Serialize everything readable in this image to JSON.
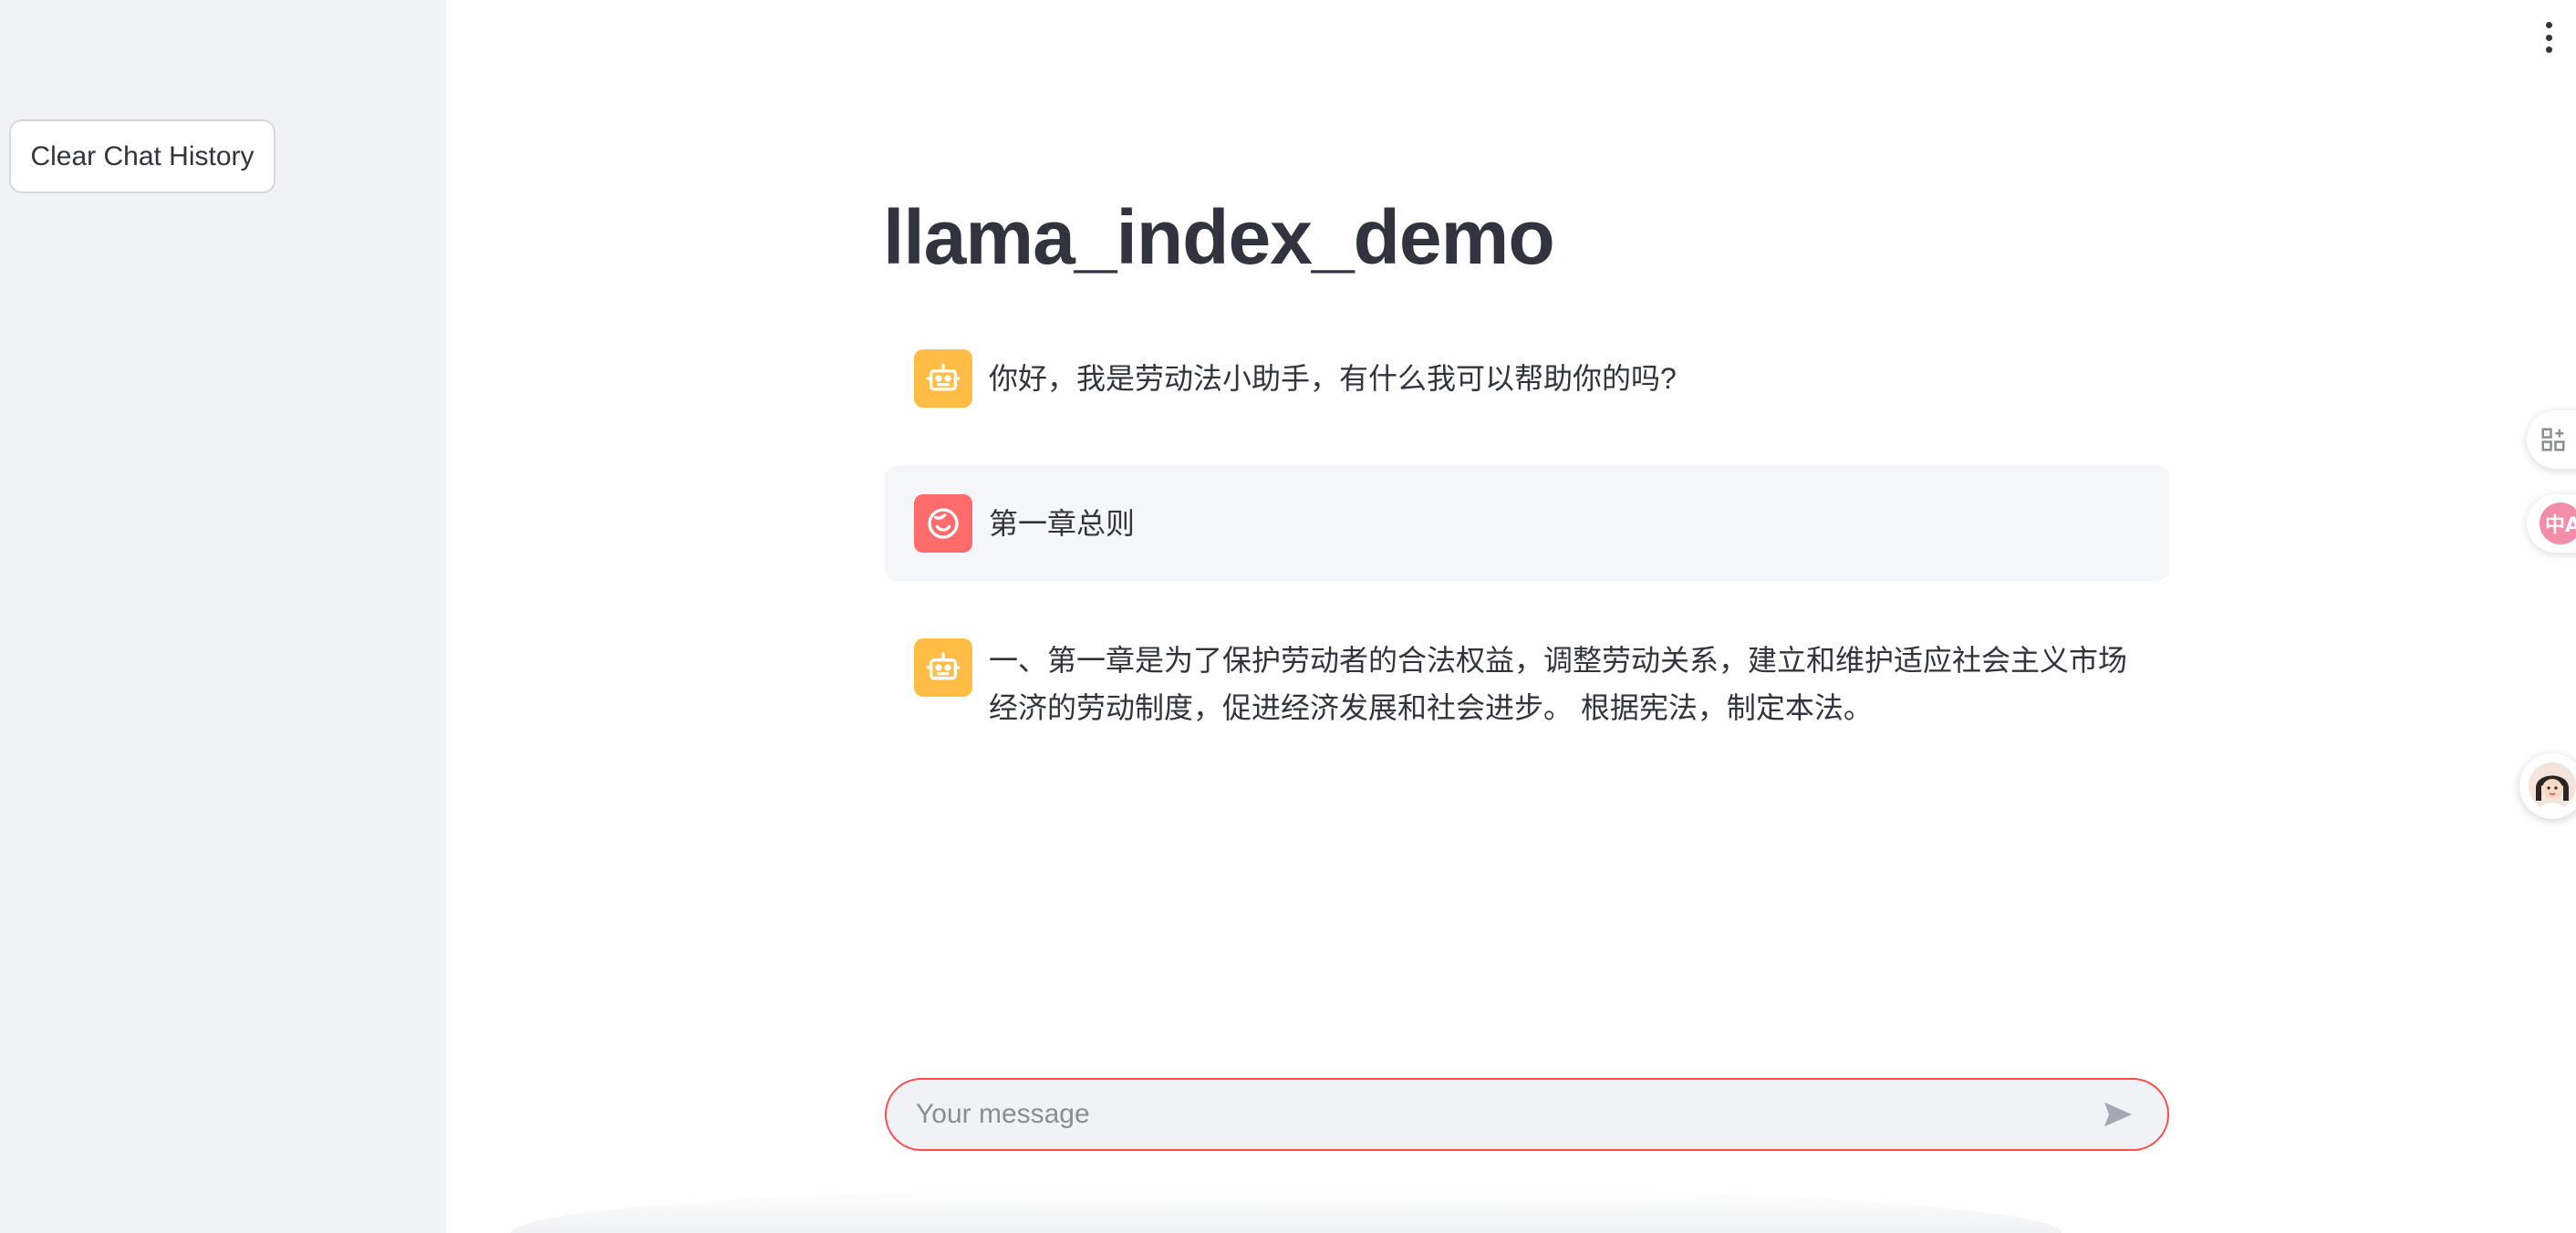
{
  "sidebar": {
    "clear_button_label": "Clear Chat History"
  },
  "main": {
    "title": "llama_index_demo"
  },
  "messages": [
    {
      "role": "assistant",
      "text": "你好，我是劳动法小助手，有什么我可以帮助你的吗?"
    },
    {
      "role": "user",
      "text": "第一章总则"
    },
    {
      "role": "assistant",
      "text": "一、第一章是为了保护劳动者的合法权益，调整劳动关系，建立和维护适应社会主义市场经济的劳动制度，促进经济发展和社会进步。 根据宪法，制定本法。"
    }
  ],
  "chat_input": {
    "placeholder": "Your message",
    "value": ""
  },
  "floating_widgets": {
    "translate_label": "中A"
  },
  "colors": {
    "sidebar_bg": "#f0f2f6",
    "bot_avatar": "#ffbd45",
    "user_avatar": "#ff6c6c",
    "accent": "#ff4b4b",
    "text": "#31333f"
  },
  "icons": [
    "kebab-menu-icon",
    "robot-icon",
    "smiley-face-icon",
    "send-icon",
    "grid-icon",
    "translate-icon",
    "assistant-avatar-icon"
  ]
}
